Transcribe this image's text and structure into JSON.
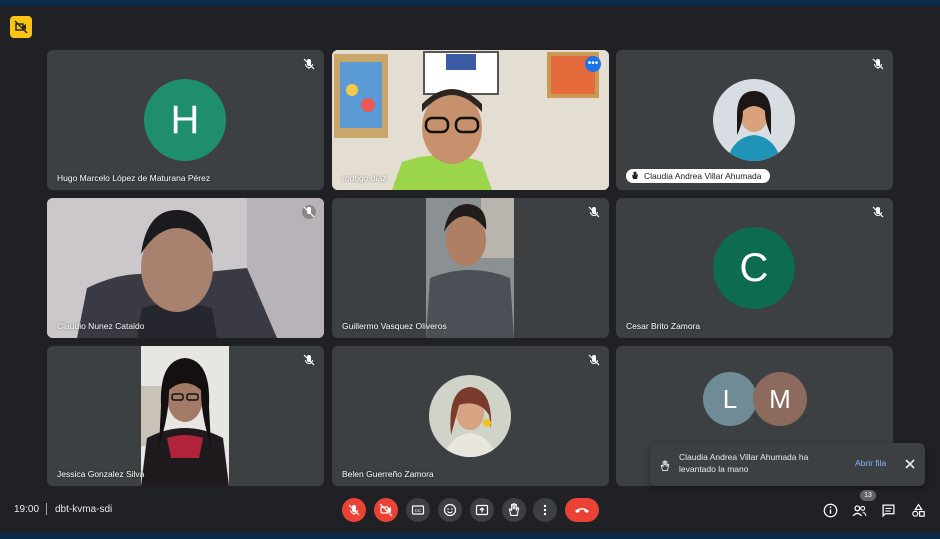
{
  "app": {
    "logo_icon": "video-off-icon",
    "accent": "#f9c514"
  },
  "participants": [
    {
      "name": "Hugo Marcelo López de Maturana Pérez",
      "initial": "H",
      "avatar_color": "#1e8e6e",
      "muted": true
    },
    {
      "name": "rodrigo diaz",
      "video": true,
      "speaking": true,
      "more_icon": "more-vert-icon"
    },
    {
      "name": "Claudia Andrea Villar Ahumada",
      "photo": true,
      "hand_raised": true,
      "muted": true
    },
    {
      "name": "Claudio Nunez Cataldo",
      "video": true,
      "muted": true
    },
    {
      "name": "Guillermo Vasquez Oliveros",
      "video": true,
      "muted": true
    },
    {
      "name": "Cesar Brito Zamora",
      "initial": "C",
      "avatar_color": "#0d6b4f",
      "muted": true
    },
    {
      "name": "Jessica Gonzalez Silva",
      "video": true,
      "muted": true
    },
    {
      "name": "Belen Guerreño Zamora",
      "photo": true,
      "muted": true
    },
    {
      "initials": [
        "L",
        "M"
      ],
      "avatar_colors": [
        "#6e8b96",
        "#8c6a5d"
      ]
    }
  ],
  "toast": {
    "message": "Claudia Andrea Villar Ahumada ha levantado la mano",
    "action": "Abrir fila",
    "icon": "hand-icon",
    "close_icon": "close-icon"
  },
  "bottom_bar": {
    "time": "19:00",
    "meeting_code": "dbt-kvma-sdi",
    "controls": [
      "mic-off-icon",
      "camera-off-icon",
      "captions-icon",
      "emoji-icon",
      "present-icon",
      "raise-hand-icon",
      "more-options-icon",
      "end-call-icon"
    ],
    "right_controls": [
      "info-icon",
      "people-icon",
      "chat-icon",
      "activities-icon"
    ],
    "people_count": "13"
  }
}
